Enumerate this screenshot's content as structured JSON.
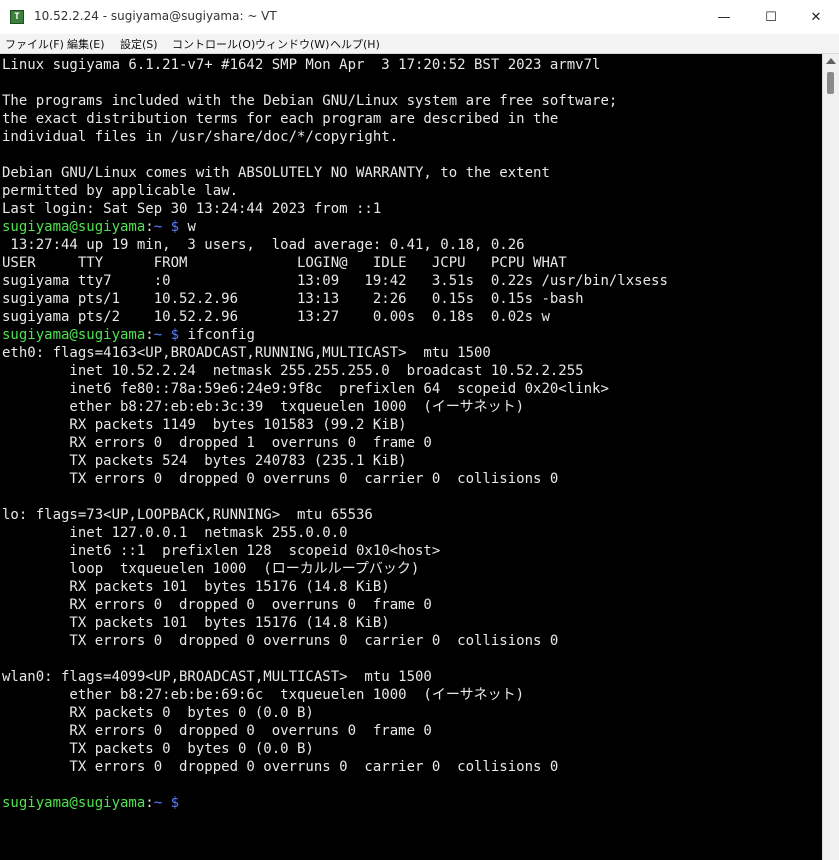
{
  "window": {
    "title": "10.52.2.24 - sugiyama@sugiyama: ~ VT",
    "icon": "T",
    "minimize": "—",
    "maximize": "☐",
    "close": "✕"
  },
  "menu": [
    "ファイル(F)",
    "編集(E)",
    "設定(S)",
    "コントロール(O)",
    "ウィンドウ(W)",
    "ヘルプ(H)"
  ],
  "prompt": {
    "user_host": "sugiyama@sugiyama",
    "sep": ":",
    "path": "~",
    "dollar": "$"
  },
  "terminal": {
    "l01": "Linux sugiyama 6.1.21-v7+ #1642 SMP Mon Apr  3 17:20:52 BST 2023 armv7l",
    "l03": "The programs included with the Debian GNU/Linux system are free software;",
    "l04": "the exact distribution terms for each program are described in the",
    "l05": "individual files in /usr/share/doc/*/copyright.",
    "l07": "Debian GNU/Linux comes with ABSOLUTELY NO WARRANTY, to the extent",
    "l08": "permitted by applicable law.",
    "l09": "Last login: Sat Sep 30 13:24:44 2023 from ::1",
    "cmd1": " w",
    "l11": " 13:27:44 up 19 min,  3 users,  load average: 0.41, 0.18, 0.26",
    "l12": "USER     TTY      FROM             LOGIN@   IDLE   JCPU   PCPU WHAT",
    "l13": "sugiyama tty7     :0               13:09   19:42   3.51s  0.22s /usr/bin/lxsess",
    "l14": "sugiyama pts/1    10.52.2.96       13:13    2:26   0.15s  0.15s -bash",
    "l15": "sugiyama pts/2    10.52.2.96       13:27    0.00s  0.18s  0.02s w",
    "cmd2": " ifconfig",
    "l17": "eth0: flags=4163<UP,BROADCAST,RUNNING,MULTICAST>  mtu 1500",
    "l18": "        inet 10.52.2.24  netmask 255.255.255.0  broadcast 10.52.2.255",
    "l19": "        inet6 fe80::78a:59e6:24e9:9f8c  prefixlen 64  scopeid 0x20<link>",
    "l20": "        ether b8:27:eb:eb:3c:39  txqueuelen 1000  (イーサネット)",
    "l21": "        RX packets 1149  bytes 101583 (99.2 KiB)",
    "l22": "        RX errors 0  dropped 1  overruns 0  frame 0",
    "l23": "        TX packets 524  bytes 240783 (235.1 KiB)",
    "l24": "        TX errors 0  dropped 0 overruns 0  carrier 0  collisions 0",
    "l26": "lo: flags=73<UP,LOOPBACK,RUNNING>  mtu 65536",
    "l27": "        inet 127.0.0.1  netmask 255.0.0.0",
    "l28": "        inet6 ::1  prefixlen 128  scopeid 0x10<host>",
    "l29": "        loop  txqueuelen 1000  (ローカルループバック)",
    "l30": "        RX packets 101  bytes 15176 (14.8 KiB)",
    "l31": "        RX errors 0  dropped 0  overruns 0  frame 0",
    "l32": "        TX packets 101  bytes 15176 (14.8 KiB)",
    "l33": "        TX errors 0  dropped 0 overruns 0  carrier 0  collisions 0",
    "l35": "wlan0: flags=4099<UP,BROADCAST,MULTICAST>  mtu 1500",
    "l36": "        ether b8:27:eb:be:69:6c  txqueuelen 1000  (イーサネット)",
    "l37": "        RX packets 0  bytes 0 (0.0 B)",
    "l38": "        RX errors 0  dropped 0  overruns 0  frame 0",
    "l39": "        TX packets 0  bytes 0 (0.0 B)",
    "l40": "        TX errors 0  dropped 0 overruns 0  carrier 0  collisions 0"
  },
  "colors": {
    "terminal_bg": "#000000",
    "terminal_fg": "#e8e8e8",
    "prompt_user": "#4ee34e",
    "prompt_path": "#5b7dff"
  }
}
